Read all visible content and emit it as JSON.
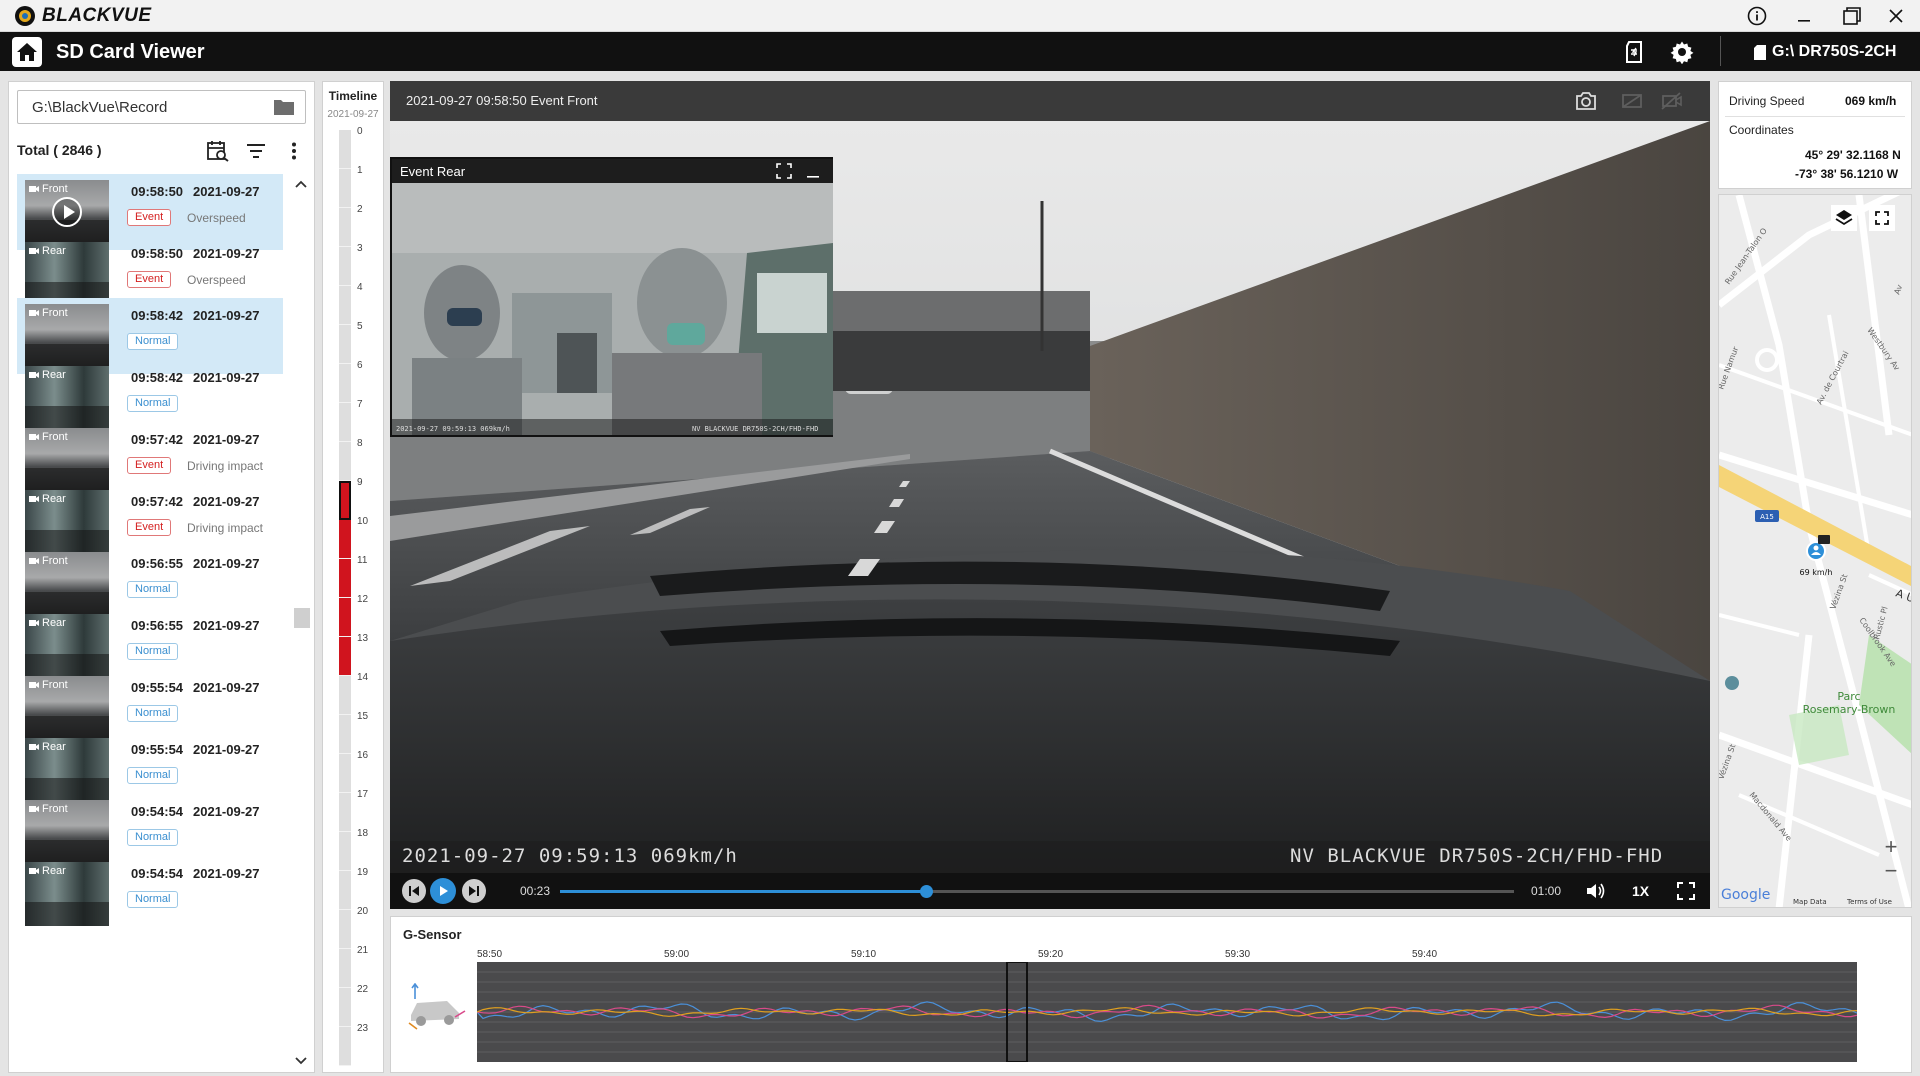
{
  "window": {
    "brand": "BLACKVUE",
    "controls": [
      "info-icon",
      "minimize-icon",
      "maximize-icon",
      "close-icon"
    ]
  },
  "appbar": {
    "title": "SD Card Viewer",
    "device": "G:\\ DR750S-2CH"
  },
  "left": {
    "path": "G:\\BlackVue\\Record",
    "total": "Total ( 2846 )",
    "items": [
      {
        "cam": "Front",
        "time": "09:58:50",
        "date": "2021-09-27",
        "badge": "Event",
        "type": "Overspeed",
        "selected": true,
        "play": true
      },
      {
        "cam": "Rear",
        "time": "09:58:50",
        "date": "2021-09-27",
        "badge": "Event",
        "type": "Overspeed",
        "selected": false
      },
      {
        "cam": "Front",
        "time": "09:58:42",
        "date": "2021-09-27",
        "badge": "Normal",
        "type": "",
        "selected": true
      },
      {
        "cam": "Rear",
        "time": "09:58:42",
        "date": "2021-09-27",
        "badge": "Normal",
        "type": "",
        "selected": false
      },
      {
        "cam": "Front",
        "time": "09:57:42",
        "date": "2021-09-27",
        "badge": "Event",
        "type": "Driving impact",
        "selected": false
      },
      {
        "cam": "Rear",
        "time": "09:57:42",
        "date": "2021-09-27",
        "badge": "Event",
        "type": "Driving impact",
        "selected": false
      },
      {
        "cam": "Front",
        "time": "09:56:55",
        "date": "2021-09-27",
        "badge": "Normal",
        "type": "",
        "selected": false
      },
      {
        "cam": "Rear",
        "time": "09:56:55",
        "date": "2021-09-27",
        "badge": "Normal",
        "type": "",
        "selected": false
      },
      {
        "cam": "Front",
        "time": "09:55:54",
        "date": "2021-09-27",
        "badge": "Normal",
        "type": "",
        "selected": false
      },
      {
        "cam": "Rear",
        "time": "09:55:54",
        "date": "2021-09-27",
        "badge": "Normal",
        "type": "",
        "selected": false
      },
      {
        "cam": "Front",
        "time": "09:54:54",
        "date": "2021-09-27",
        "badge": "Normal",
        "type": "",
        "selected": false
      },
      {
        "cam": "Rear",
        "time": "09:54:54",
        "date": "2021-09-27",
        "badge": "Normal",
        "type": "",
        "selected": false
      }
    ]
  },
  "timeline": {
    "title": "Timeline",
    "date": "2021-09-27",
    "hours": [
      "0",
      "1",
      "2",
      "3",
      "4",
      "5",
      "6",
      "7",
      "8",
      "9",
      "10",
      "11",
      "12",
      "13",
      "14",
      "15",
      "16",
      "17",
      "18",
      "19",
      "20",
      "21",
      "22",
      "23"
    ],
    "active_hours": [
      9,
      10,
      11,
      12,
      13
    ],
    "current_hour": 9,
    "active_color": "#d0141e"
  },
  "player": {
    "title": "2021-09-27 09:58:50 Event Front",
    "pip_title": "Event Rear",
    "osd_left": "2021-09-27  09:59:13   069km/h",
    "osd_right": "NV   BLACKVUE DR750S-2CH/FHD-FHD",
    "pip_osd_left": "2021-09-27  09:59:13  069km/h",
    "pip_osd_right": "NV  BLACKVUE DR750S-2CH/FHD-FHD",
    "elapsed": "00:23",
    "duration": "01:00",
    "progress_fraction": 0.3833,
    "speed": "1X",
    "accent": "#2d8fd8"
  },
  "info": {
    "speed_label": "Driving Speed",
    "speed_value": "069 km/h",
    "coord_label": "Coordinates",
    "lat": "45° 29' 32.1168 N",
    "lon": "-73° 38' 56.1210 W"
  },
  "map": {
    "streets": [
      "Rue Jean-Talon O",
      "Rue Namur",
      "Av. de Courtrai",
      "Westbury Av",
      "Vézina St",
      "Coolbrook Ave",
      "Rustic Pl",
      "Vézina St",
      "Macdonald Ave",
      "Av"
    ],
    "highway_badge": "A15",
    "highway_label": "A U",
    "marker_label": "69 km/h",
    "park_label_1": "Parc",
    "park_label_2": "Rosemary-Brown",
    "zoom_in": "+",
    "zoom_out": "−",
    "attribution_logo": "Google",
    "map_data": "Map Data",
    "terms": "Terms of Use"
  },
  "gsensor": {
    "title": "G-Sensor",
    "ticks": [
      "58:50",
      "59:00",
      "59:10",
      "59:20",
      "59:30",
      "59:40"
    ]
  }
}
